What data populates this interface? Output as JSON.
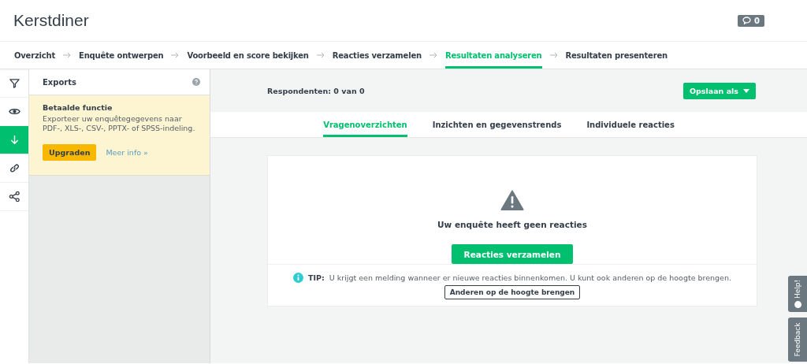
{
  "header": {
    "title": "Kerstdiner",
    "comments_badge": "0"
  },
  "steps": [
    {
      "label": "Overzicht",
      "selected": false
    },
    {
      "label": "Enquête ontwerpen",
      "selected": false
    },
    {
      "label": "Voorbeeld en score bekijken",
      "selected": false
    },
    {
      "label": "Reacties verzamelen",
      "selected": false
    },
    {
      "label": "Resultaten analyseren",
      "selected": true
    },
    {
      "label": "Resultaten presenteren",
      "selected": false
    }
  ],
  "rail": [
    {
      "kind": "filter",
      "selected": false
    },
    {
      "kind": "eye",
      "selected": false
    },
    {
      "kind": "download",
      "selected": true
    },
    {
      "kind": "link",
      "selected": false
    },
    {
      "kind": "share",
      "selected": false
    }
  ],
  "panel": {
    "title": "Exports",
    "notice": {
      "title": "Betaalde functie",
      "text": "Exporteer uw enquêtegegevens naar PDF-, XLS-, CSV-, PPTX- of SPSS-indeling.",
      "button": "Upgraden",
      "link": "Meer info »"
    }
  },
  "main": {
    "respondents": "Respondenten: 0 van 0",
    "save_button": "Opslaan als",
    "tabs": [
      {
        "label": "Vragenoverzichten",
        "selected": true
      },
      {
        "label": "Inzichten en gegevenstrends",
        "selected": false
      },
      {
        "label": "Individuele reacties",
        "selected": false
      }
    ],
    "empty": {
      "message": "Uw enquête heeft geen reacties",
      "button": "Reacties verzamelen"
    },
    "tip": {
      "label": "TIP:",
      "text": "U krijgt een melding wanneer er nieuwe reacties binnenkomen. U kunt ook anderen op de hoogte brengen.",
      "button": "Anderen op de hoogte brengen"
    }
  },
  "side_tabs": [
    "Help!",
    "Feedback"
  ]
}
